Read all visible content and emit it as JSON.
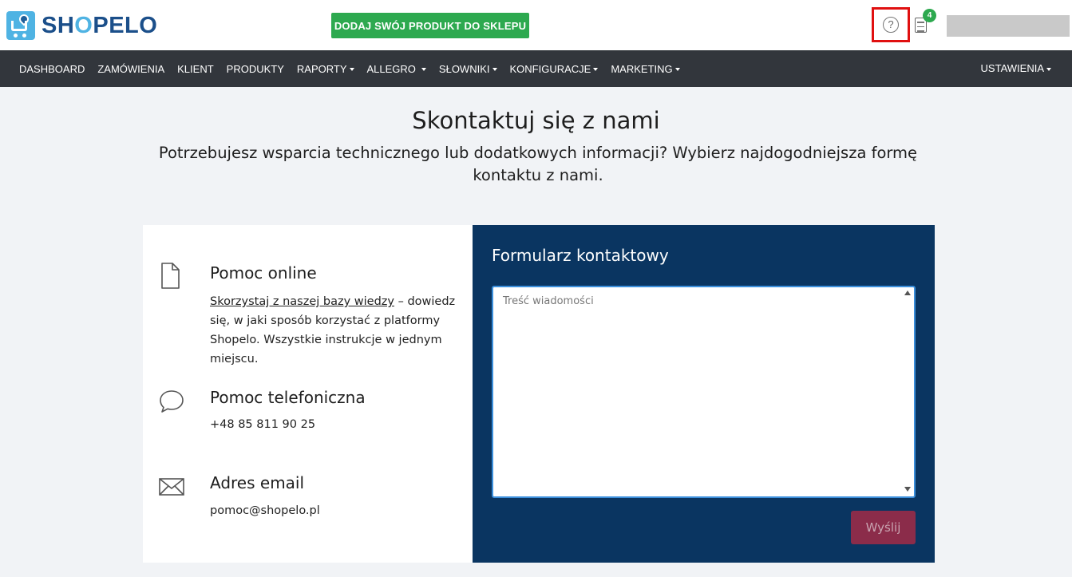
{
  "header": {
    "logo_prefix": "SH",
    "logo_o": "O",
    "logo_suffix": "PELO",
    "cta_label": "DODAJ SWÓJ PRODUKT DO SKLEPU",
    "help_glyph": "?",
    "notification_count": "4",
    "icons": {
      "help": "question-circle-icon",
      "notifications": "document-icon"
    }
  },
  "nav": {
    "items": [
      {
        "label": "DASHBOARD",
        "dropdown": false
      },
      {
        "label": "ZAMÓWIENIA",
        "dropdown": false
      },
      {
        "label": "KLIENT",
        "dropdown": false
      },
      {
        "label": "PRODUKTY",
        "dropdown": false
      },
      {
        "label": "RAPORTY",
        "dropdown": true
      },
      {
        "label": "ALLEGRO",
        "dropdown": true
      },
      {
        "label": "SŁOWNIKI",
        "dropdown": true
      },
      {
        "label": "KONFIGURACJE",
        "dropdown": true
      },
      {
        "label": "MARKETING",
        "dropdown": true
      }
    ],
    "right_item": "USTAWIENIA"
  },
  "page": {
    "title": "Skontaktuj się z nami",
    "subtitle": "Potrzebujesz wsparcia technicznego lub dodatkowych informacji? Wybierz najdogodniejsza formę kontaktu z nami."
  },
  "contact": {
    "online": {
      "title": "Pomoc online",
      "link_text": "Skorzystaj z naszej bazy wiedzy",
      "text": " – dowiedz się, w jaki sposób korzystać z platformy Shopelo. Wszystkie instrukcje w jednym miejscu."
    },
    "phone": {
      "title": "Pomoc telefoniczna",
      "value": "+48 85 811 90 25"
    },
    "email": {
      "title": "Adres email",
      "value": "pomoc@shopelo.pl"
    }
  },
  "form": {
    "title": "Formularz kontaktowy",
    "placeholder": "Treść wiadomości",
    "send_label": "Wyślij"
  },
  "colors": {
    "brand_blue": "#1b4f8a",
    "brand_light": "#4fb3e3",
    "cta_green": "#2da94f",
    "nav_bg": "#32363c",
    "form_bg": "#0a3561",
    "send_btn": "#8b2c4a",
    "highlight": "#e01010"
  }
}
